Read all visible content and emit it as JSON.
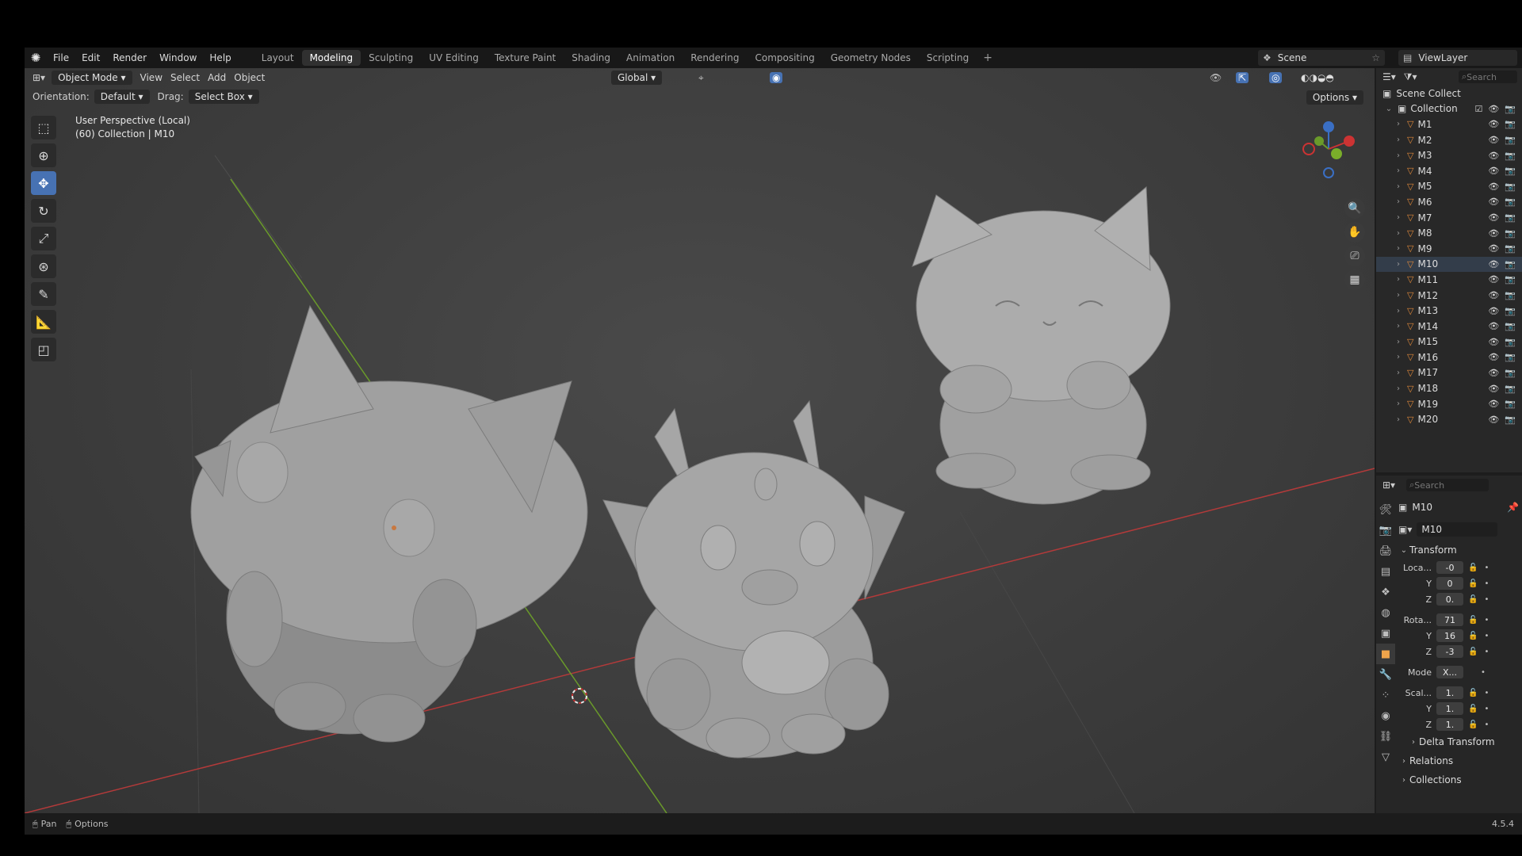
{
  "menubar": {
    "items": [
      "File",
      "Edit",
      "Render",
      "Window",
      "Help"
    ],
    "workspaces": [
      "Layout",
      "Modeling",
      "Sculpting",
      "UV Editing",
      "Texture Paint",
      "Shading",
      "Animation",
      "Rendering",
      "Compositing",
      "Geometry Nodes",
      "Scripting"
    ],
    "active_workspace": "Modeling",
    "scene": "Scene",
    "view_layer": "ViewLayer"
  },
  "viewport": {
    "mode": "Object Mode",
    "menus": [
      "View",
      "Select",
      "Add",
      "Object"
    ],
    "orientation_label": "Orientation:",
    "orientation_value": "Default",
    "drag_label": "Drag:",
    "drag_value": "Select Box",
    "transform_orientation": "Global",
    "options": "Options",
    "perspective_title": "User Perspective (Local)",
    "perspective_info": "(60) Collection | M10"
  },
  "outliner": {
    "search_placeholder": "Search",
    "scene_collection": "Scene Collect",
    "collection": "Collection",
    "objects": [
      "M1",
      "M2",
      "M3",
      "M4",
      "M5",
      "M6",
      "M7",
      "M8",
      "M9",
      "M10",
      "M11",
      "M12",
      "M13",
      "M14",
      "M15",
      "M16",
      "M17",
      "M18",
      "M19",
      "M20"
    ],
    "selected": "M10"
  },
  "properties": {
    "search_placeholder": "Search",
    "object_name": "M10",
    "data_name": "M10",
    "transform_title": "Transform",
    "location_label": "Loca...",
    "location": [
      "-0",
      "0",
      "0."
    ],
    "rotation_label": "Rota...",
    "rotation": [
      "71",
      "16",
      "-3"
    ],
    "mode_label": "Mode",
    "mode_value": "X...",
    "scale_label": "Scal...",
    "scale": [
      "1.",
      "1.",
      "1."
    ],
    "axis_y": "Y",
    "axis_z": "Z",
    "delta_transform": "Delta Transform",
    "relations": "Relations",
    "collections": "Collections"
  },
  "statusbar": {
    "pan": "Pan",
    "options": "Options",
    "version": "4.5.4"
  },
  "colors": {
    "accent_blue": "#4772b3",
    "object_orange": "#e0893a",
    "axis_red": "#b33a3a",
    "axis_green": "#6a9a2a"
  }
}
